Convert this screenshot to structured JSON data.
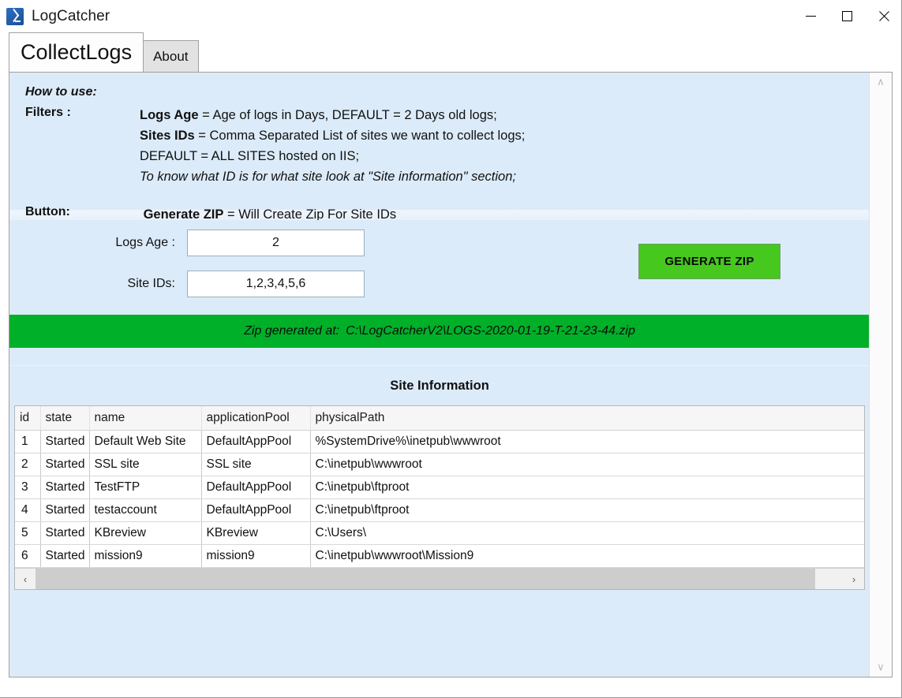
{
  "window": {
    "title": "LogCatcher",
    "icon": "powershell-icon",
    "controls": {
      "minimize": "minimize-icon",
      "maximize": "maximize-icon",
      "close": "close-icon"
    }
  },
  "tabs": [
    {
      "label": "CollectLogs",
      "active": true
    },
    {
      "label": "About",
      "active": false
    }
  ],
  "help": {
    "title": "How to use:",
    "filters_label": "Filters :",
    "lines": [
      {
        "bold": "Logs Age",
        "rest": " = Age of logs in Days, DEFAULT = 2 Days old logs;"
      },
      {
        "bold": "Sites IDs",
        "rest": " = Comma Separated List of sites we want to collect logs;"
      },
      {
        "bold": "",
        "rest": "DEFAULT  =  ALL SITES hosted on IIS;"
      },
      {
        "bold": "",
        "rest": "To know what ID is for what site look at \"Site information\" section;",
        "italic": true
      }
    ],
    "button_label": "Button:",
    "button_line": {
      "bold": "Generate ZIP",
      "rest": " = Will Create Zip For Site IDs"
    }
  },
  "form": {
    "logs_age_label": "Logs Age :",
    "logs_age_value": "2",
    "logs_age_placeholder": "2",
    "site_ids_label": "Site IDs:",
    "site_ids_value": "1,2,3,4,5,6",
    "site_ids_placeholder": "1,2,3,4,5,6",
    "generate_button": "GENERATE ZIP",
    "generate_button_color": "#46c81e"
  },
  "status": {
    "label": "Zip generated at:",
    "path": "C:\\LogCatcherV2\\LOGS-2020-01-19-T-21-23-44.zip",
    "background_color": "#00b028"
  },
  "site_information": {
    "title": "Site Information",
    "columns": [
      "id",
      "state",
      "name",
      "applicationPool",
      "physicalPath"
    ],
    "rows": [
      {
        "id": "1",
        "state": "Started",
        "name": "Default Web Site",
        "applicationPool": "DefaultAppPool",
        "physicalPath": "%SystemDrive%\\inetpub\\wwwroot"
      },
      {
        "id": "2",
        "state": "Started",
        "name": "SSL site",
        "applicationPool": "SSL site",
        "physicalPath": "C:\\inetpub\\wwwroot"
      },
      {
        "id": "3",
        "state": "Started",
        "name": "TestFTP",
        "applicationPool": "DefaultAppPool",
        "physicalPath": "C:\\inetpub\\ftproot"
      },
      {
        "id": "4",
        "state": "Started",
        "name": "testaccount",
        "applicationPool": "DefaultAppPool",
        "physicalPath": "C:\\inetpub\\ftproot"
      },
      {
        "id": "5",
        "state": "Started",
        "name": "KBreview",
        "applicationPool": "KBreview",
        "physicalPath": "C:\\Users\\"
      },
      {
        "id": "6",
        "state": "Started",
        "name": "mission9",
        "applicationPool": "mission9",
        "physicalPath": "C:\\inetpub\\wwwroot\\Mission9"
      }
    ]
  },
  "scrollbars": {
    "horizontal_left": "‹",
    "horizontal_right": "›",
    "vertical_up": "∧",
    "vertical_down": "∨"
  },
  "theme": {
    "panel_background": "#dcebf9",
    "accent_green": "#46c81e",
    "status_green": "#00b028"
  }
}
